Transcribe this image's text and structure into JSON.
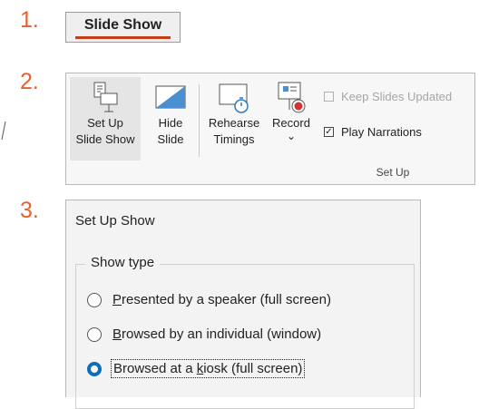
{
  "steps": {
    "one": "1.",
    "two": "2.",
    "three": "3."
  },
  "tab": {
    "label": "Slide Show",
    "accent": "#c43e1c"
  },
  "ribbon": {
    "setup_slideshow": {
      "line1": "Set Up",
      "line2": "Slide Show"
    },
    "hide_slide": {
      "line1": "Hide",
      "line2": "Slide"
    },
    "rehearse_timings": {
      "line1": "Rehearse",
      "line2": "Timings"
    },
    "record": {
      "line1": "Record",
      "chevron": "⌄"
    },
    "keep_slides_updated": {
      "label": "Keep Slides Updated",
      "checked": false,
      "disabled": true
    },
    "play_narrations": {
      "label": "Play Narrations",
      "checked": true
    },
    "group_label": "Set Up"
  },
  "dialog": {
    "title": "Set Up Show",
    "show_type_legend": "Show type",
    "options": [
      {
        "pre": "",
        "key": "P",
        "post": "resented by a speaker (full screen)",
        "checked": false
      },
      {
        "pre": "",
        "key": "B",
        "post": "rowsed by an individual (window)",
        "checked": false
      },
      {
        "pre": "Browsed at a ",
        "key": "k",
        "post": "iosk (full screen)",
        "checked": true
      }
    ],
    "accent": "#0f6cbd"
  }
}
